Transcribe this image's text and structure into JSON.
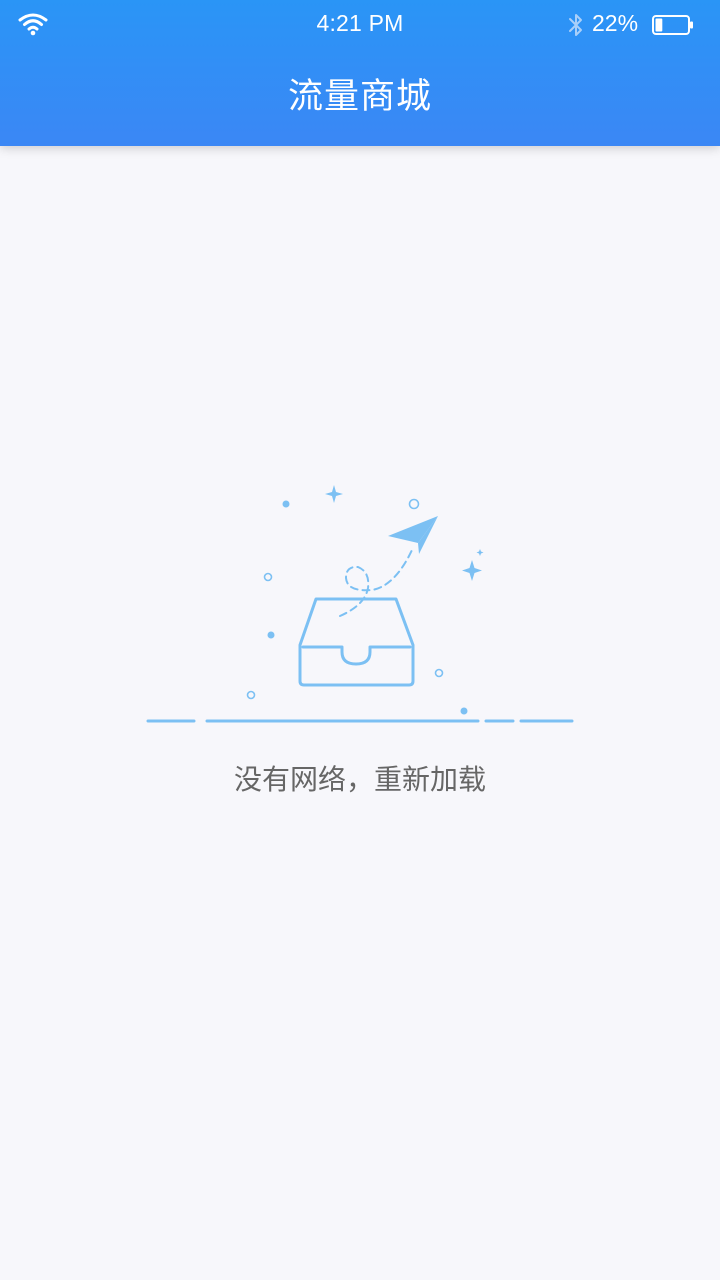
{
  "status_bar": {
    "time": "4:21 PM",
    "battery_percent": "22%",
    "battery_level": 0.22,
    "wifi_icon": "wifi-icon",
    "bluetooth_icon": "bluetooth-icon"
  },
  "header": {
    "title": "流量商城",
    "background_color": "#2a95f6"
  },
  "empty_state": {
    "illustration_icon": "paper-plane-inbox-illustration",
    "message": "没有网络，重新加载",
    "accent_color": "#7cc0f3",
    "text_color": "#666666"
  }
}
